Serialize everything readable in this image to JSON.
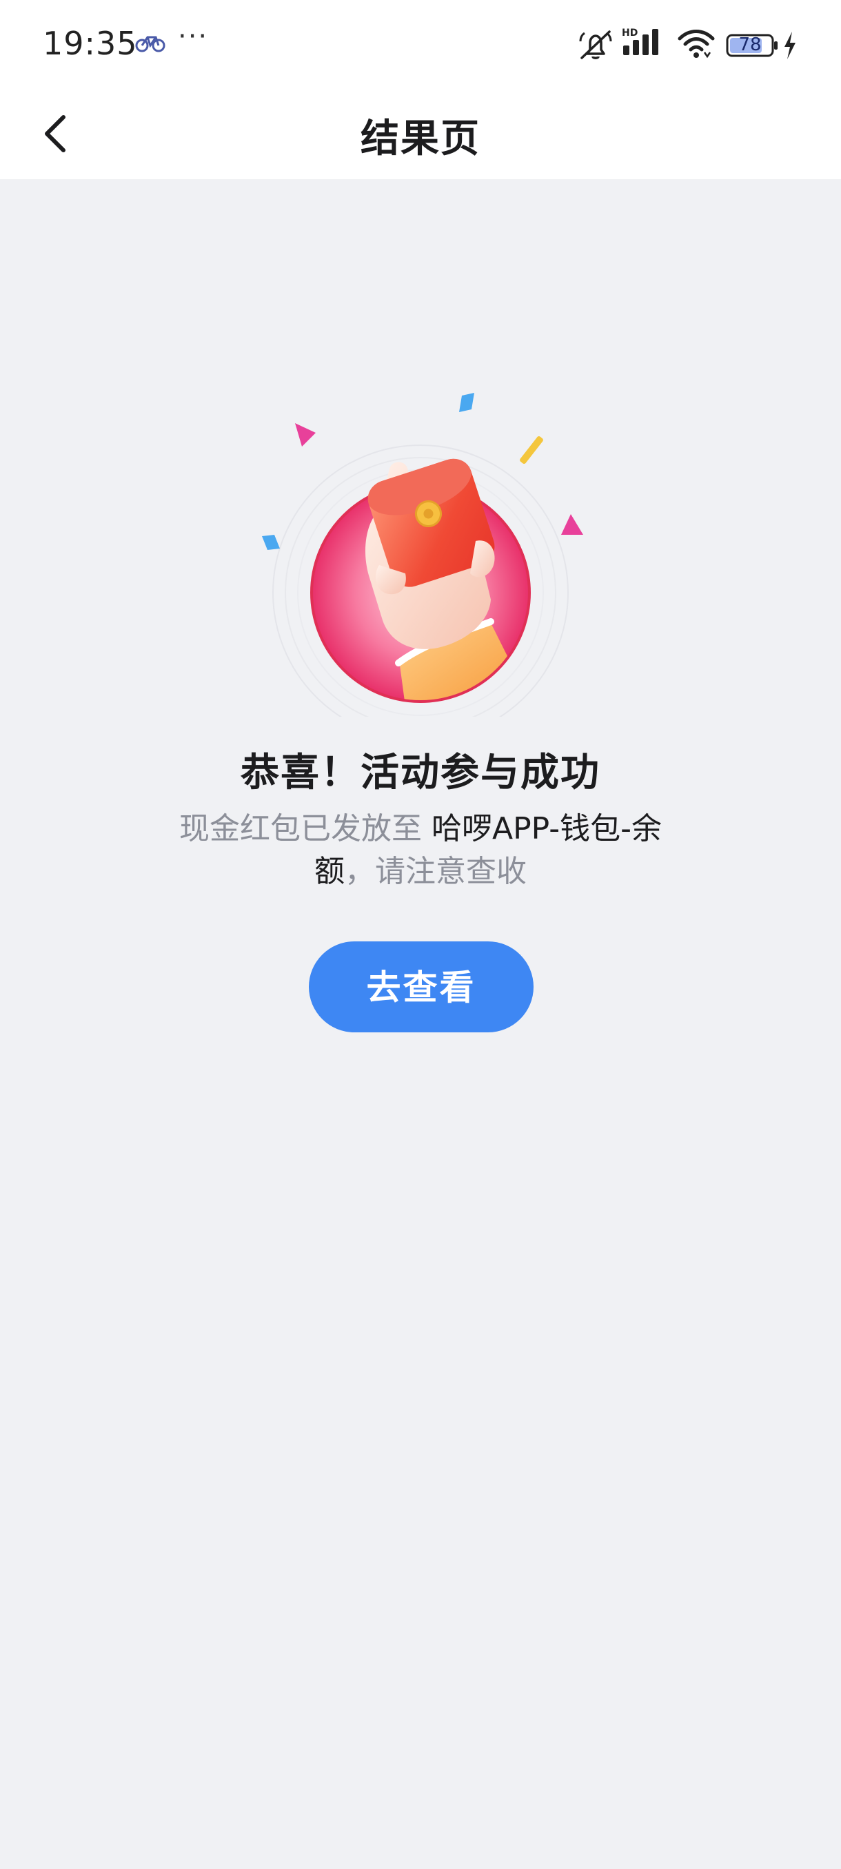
{
  "status_bar": {
    "time": "19:35",
    "more_indicator": "···",
    "battery_level": "78",
    "icons": [
      "bike-icon",
      "mute-icon",
      "hd-signal-icon",
      "wifi-icon",
      "battery-icon",
      "charging-icon"
    ]
  },
  "nav": {
    "back_icon": "chevron-left-icon",
    "title": "结果页"
  },
  "result": {
    "title": "恭喜！活动参与成功",
    "desc_prefix": "现金红包已发放至 ",
    "desc_location_line1": "哈啰APP-钱包-余",
    "desc_location_line2": "额",
    "desc_suffix": "，请注意查收",
    "button_label": "去查看"
  },
  "colors": {
    "background": "#f0f1f4",
    "primary_button": "#3e87f3",
    "secondary_text": "#8c8f99",
    "primary_text": "#1c1c1e"
  }
}
